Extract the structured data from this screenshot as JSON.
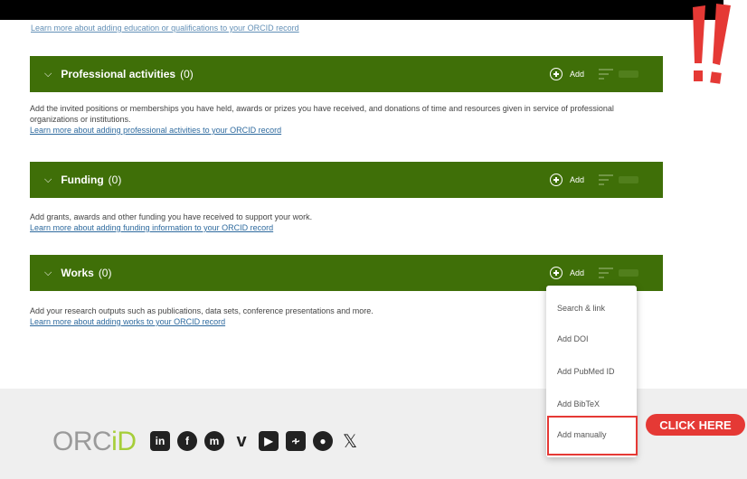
{
  "top_link": "Learn more about adding education or qualifications to your ORCID record",
  "sections": [
    {
      "title": "Professional activities",
      "count": "(0)",
      "add_label": "Add",
      "description": "Add the invited positions or memberships you have held, awards or prizes you have received, and donations of time and resources given in service of professional organizations or institutions.",
      "link": "Learn more about adding professional activities to your ORCID record"
    },
    {
      "title": "Funding",
      "count": "(0)",
      "add_label": "Add",
      "description": "Add grants, awards and other funding you have received to support your work.",
      "link": "Learn more about adding funding information to your ORCID record"
    },
    {
      "title": "Works",
      "count": "(0)",
      "add_label": "Add",
      "description": "Add your research outputs such as publications, data sets, conference presentations and more.",
      "link": "Learn more about adding works to your ORCID record"
    }
  ],
  "dropdown": {
    "items": [
      "Search & link",
      "Add DOI",
      "Add PubMed ID",
      "Add BibTeX",
      "Add manually"
    ]
  },
  "callout": "CLICK HERE",
  "footer": {
    "logo_main": "ORC",
    "logo_accent": "iD",
    "social_icons": [
      "linkedin-icon",
      "facebook-icon",
      "mastodon-icon",
      "vimeo-icon",
      "youtube-icon",
      "rss-icon",
      "github-icon",
      "x-icon"
    ]
  },
  "colors": {
    "section_bar": "#3f6f08",
    "link": "#2e6a9e",
    "highlight": "#e53935",
    "orcid_green": "#a6ce39"
  }
}
